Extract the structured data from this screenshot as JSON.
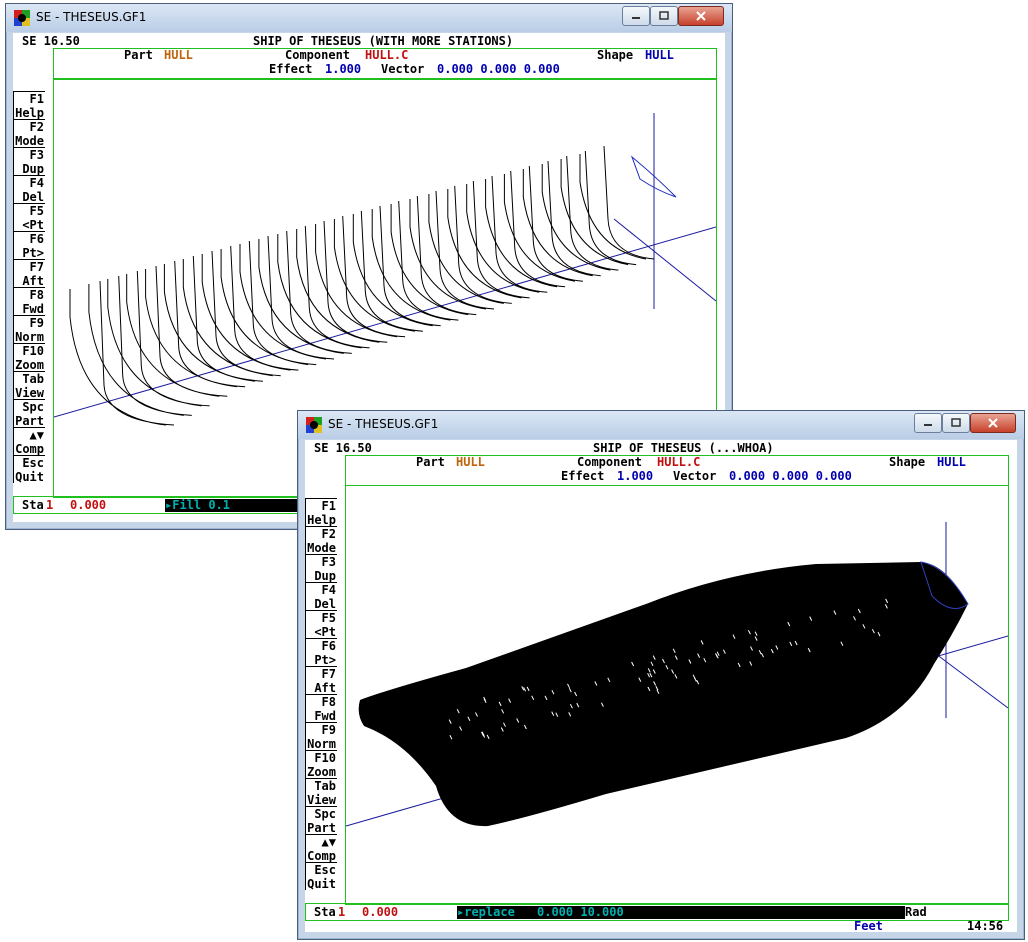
{
  "window1": {
    "title": "SE - THESEUS.GF1",
    "version": "SE 16.50",
    "heading": "SHIP OF THESEUS (WITH MORE STATIONS)",
    "part_label": "Part",
    "part_value": "HULL",
    "component_label": "Component",
    "component_value": "HULL.C",
    "shape_label": "Shape",
    "shape_value": "HULL",
    "effect_label": "Effect",
    "effect_value": "1.000",
    "vector_label": "Vector",
    "vector_value": "0.000 0.000 0.000",
    "sta_label": "Sta",
    "sta_index": "1",
    "sta_value": "0.000",
    "command": "▸Fill 0.1"
  },
  "window2": {
    "title": "SE - THESEUS.GF1",
    "version": "SE 16.50",
    "heading": "SHIP OF THESEUS (...WHOA)",
    "part_label": "Part",
    "part_value": "HULL",
    "component_label": "Component",
    "component_value": "HULL.C",
    "shape_label": "Shape",
    "shape_value": "HULL",
    "effect_label": "Effect",
    "effect_value": "1.000",
    "vector_label": "Vector",
    "vector_value": "0.000 0.000 0.000",
    "sta_label": "Sta",
    "sta_index": "1",
    "sta_value": "0.000",
    "command": "▸replace",
    "command_input": "0.000 10.000",
    "units_angle": "Rad",
    "units_length": "Feet",
    "clock": "14:56"
  },
  "fkeys": [
    {
      "key": "F1",
      "label": "Help"
    },
    {
      "key": "F2",
      "label": "Mode"
    },
    {
      "key": "F3",
      "label": "Dup"
    },
    {
      "key": "F4",
      "label": "Del"
    },
    {
      "key": "F5",
      "label": "<Pt"
    },
    {
      "key": "F6",
      "label": "Pt>"
    },
    {
      "key": "F7",
      "label": "Aft"
    },
    {
      "key": "F8",
      "label": "Fwd"
    },
    {
      "key": "F9",
      "label": "Norm"
    },
    {
      "key": "F10",
      "label": "Zoom"
    },
    {
      "key": "Tab",
      "label": "View"
    },
    {
      "key": "Spc",
      "label": "Part"
    },
    {
      "key": "▲▼",
      "label": "Comp"
    },
    {
      "key": "Esc",
      "label": "Quit"
    }
  ],
  "colors": {
    "accent_green": "#20c020",
    "value_orange": "#c0640a",
    "value_red": "#c01010",
    "value_blue": "#0000b0",
    "command_cyan": "#00b0b0"
  },
  "icons": [
    "app-icon",
    "minimize-icon",
    "maximize-icon",
    "close-icon"
  ]
}
